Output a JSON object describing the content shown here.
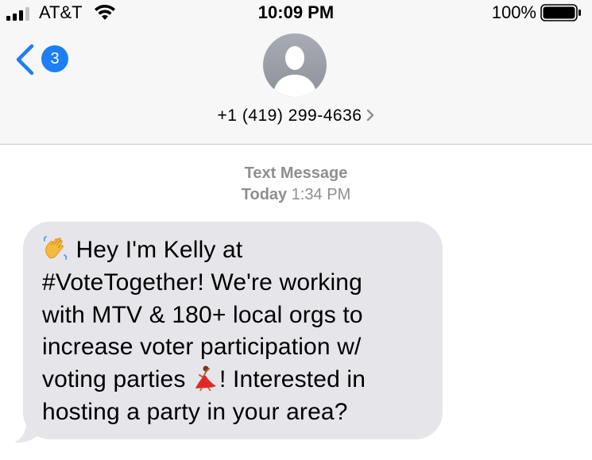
{
  "status_bar": {
    "carrier": "AT&T",
    "time": "10:09 PM",
    "battery_percent": "100%",
    "signal_icon": "cellular-signal-icon",
    "wifi_icon": "wifi-icon",
    "battery_icon": "battery-full-icon"
  },
  "nav": {
    "back_badge_count": "3",
    "back_icon": "chevron-left-icon",
    "avatar_icon": "person-silhouette-icon",
    "contact_phone": "+1 (419) 299-4636",
    "contact_chevron_icon": "chevron-right-icon"
  },
  "conversation": {
    "service_label": "Text Message",
    "day": "Today",
    "time": "1:34 PM",
    "messages": [
      {
        "direction": "incoming",
        "lead_emoji": "waving-hand-emoji",
        "lines": [
          " Hey I'm Kelly at",
          "#VoteTogether! We're working",
          "with MTV & 180+ local orgs to",
          "increase voter participation w/",
          "voting parties ",
          "! Interested in",
          "hosting a party in your area?"
        ],
        "inline_emoji": "dancing-woman-emoji"
      }
    ]
  },
  "colors": {
    "accent_blue": "#1d7ef5",
    "bubble_gray": "#e5e5ea",
    "secondary_text": "#8e8e93",
    "header_bg": "#f7f7f7"
  }
}
